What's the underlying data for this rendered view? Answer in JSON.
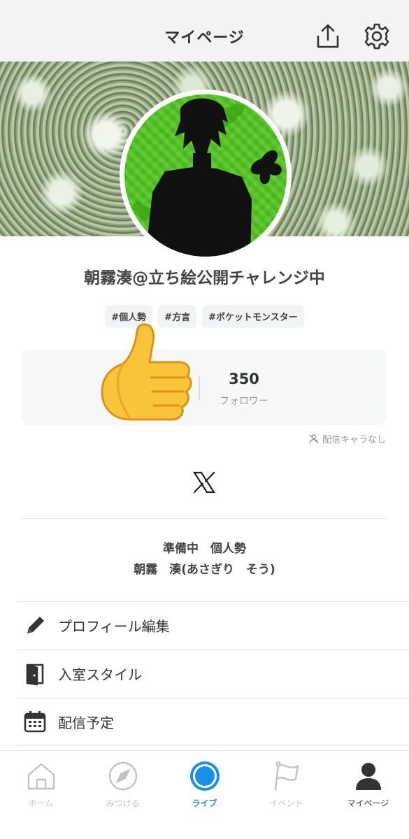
{
  "header": {
    "title": "マイページ",
    "share_icon": "share-icon",
    "settings_icon": "gear-icon"
  },
  "profile": {
    "name": "朝霧湊@立ち絵公開チャレンジ中",
    "tags": [
      "#個人勢",
      "#方言",
      "#ポケットモンスター"
    ],
    "avatar_ring_color": "#ffffff",
    "avatar_bg_color": "#4ec21c"
  },
  "stats": {
    "followers_value": "350",
    "followers_label": "フォロワー"
  },
  "no_character": {
    "label": "配信キャラなし",
    "icon": "no-character-icon"
  },
  "social": {
    "x_icon": "x-logo-icon"
  },
  "bio": {
    "text": "準備中　個人勢\n朝霧　湊(あさぎり　そう)"
  },
  "menu": {
    "items": [
      {
        "label": "プロフィール編集",
        "icon": "pencil-icon"
      },
      {
        "label": "入室スタイル",
        "icon": "door-icon"
      },
      {
        "label": "配信予定",
        "icon": "calendar-icon"
      }
    ]
  },
  "tabbar": {
    "tabs": [
      {
        "label": "ホーム",
        "icon": "home-icon"
      },
      {
        "label": "みつける",
        "icon": "compass-icon"
      },
      {
        "label": "ライブ",
        "icon": "live-icon"
      },
      {
        "label": "イベント",
        "icon": "flag-icon"
      },
      {
        "label": "マイページ",
        "icon": "person-icon"
      }
    ],
    "active_tab": "マイページ",
    "accent_color": "#1a8fe8"
  },
  "overlay": {
    "emoji": "thumbs-up-emoji"
  }
}
